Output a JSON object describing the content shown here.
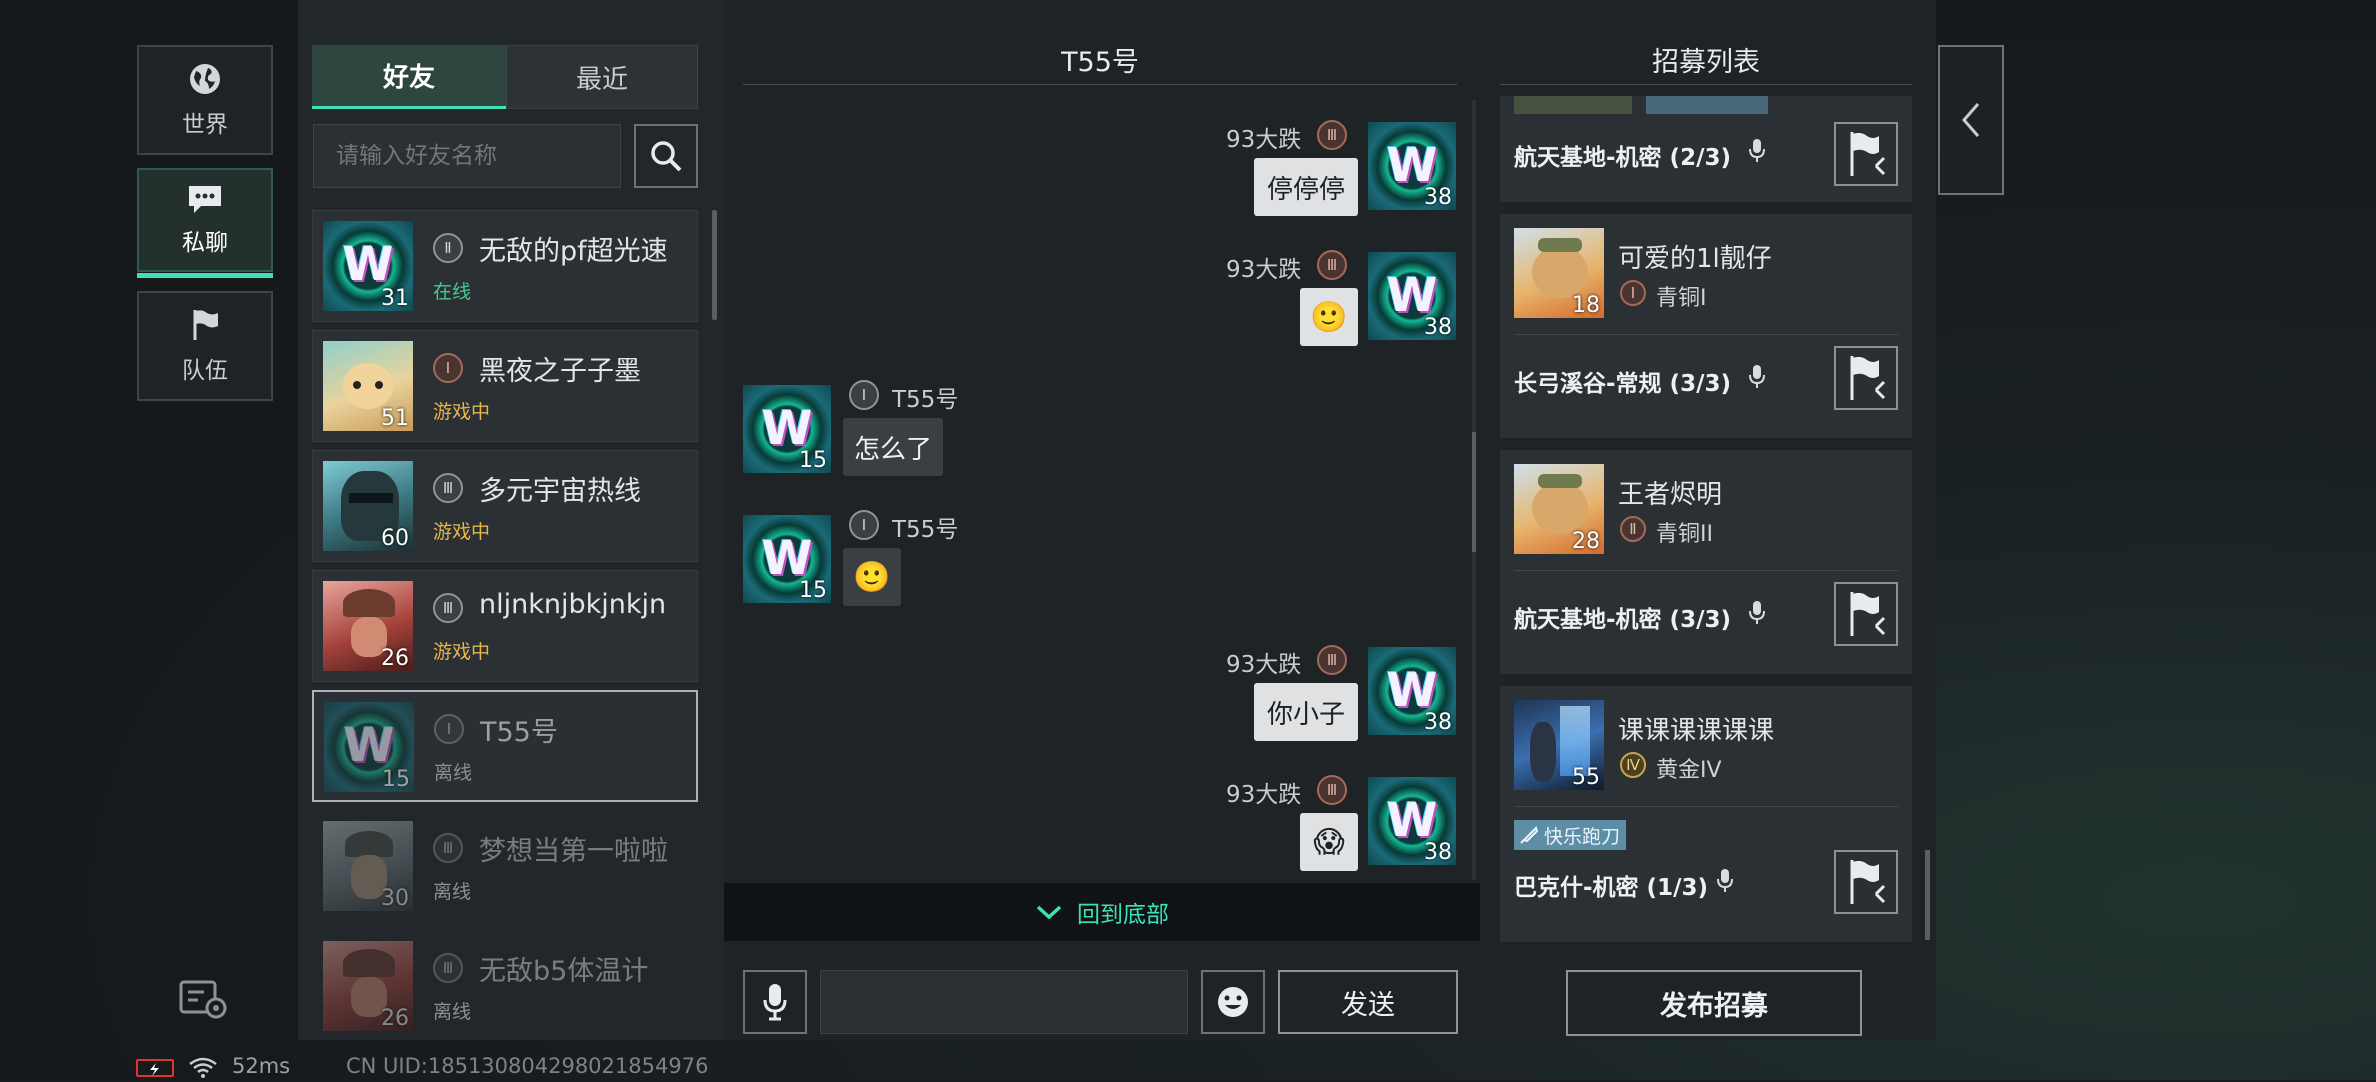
{
  "nav": {
    "world_label": "世界",
    "private_label": "私聊",
    "team_label": "队伍"
  },
  "friends_panel": {
    "tab_friends": "好友",
    "tab_recent": "最近",
    "search_placeholder": "请输入好友名称",
    "friends": [
      {
        "name": "无敌的pf超光速",
        "status": "在线",
        "level": "31",
        "rank_numeral": "Ⅱ",
        "avatar": "w-logo",
        "status_color": "#49c98e"
      },
      {
        "name": "黑夜之子子墨",
        "status": "游戏中",
        "level": "51",
        "rank_numeral": "Ⅰ",
        "avatar": "cartoon-dog",
        "status_color": "#e6b64a"
      },
      {
        "name": "多元宇宙热线",
        "status": "游戏中",
        "level": "60",
        "rank_numeral": "Ⅲ",
        "avatar": "armored-soldier",
        "status_color": "#e6b64a"
      },
      {
        "name": "nljnknjbkjnkjn",
        "status": "游戏中",
        "level": "26",
        "rank_numeral": "Ⅲ",
        "avatar": "red-soldier",
        "status_color": "#e6b64a"
      },
      {
        "name": "T55号",
        "status": "离线",
        "level": "15",
        "rank_numeral": "Ⅰ",
        "avatar": "w-logo",
        "status_color": "#8a8f93"
      },
      {
        "name": "梦想当第一啦啦",
        "status": "离线",
        "level": "30",
        "rank_numeral": "Ⅲ",
        "avatar": "soldier-portrait",
        "status_color": "#8a8f93"
      },
      {
        "name": "无敌b5体温计",
        "status": "离线",
        "level": "26",
        "rank_numeral": "Ⅲ",
        "avatar": "red-soldier",
        "status_color": "#8a8f93"
      }
    ]
  },
  "chat": {
    "title": "T55号",
    "messages": [
      {
        "side": "right",
        "sender": "93大跌",
        "rank_numeral": "Ⅲ",
        "text": "停停停",
        "level": "38"
      },
      {
        "side": "right",
        "sender": "93大跌",
        "rank_numeral": "Ⅲ",
        "text": "🙂",
        "level": "38"
      },
      {
        "side": "left",
        "sender": "T55号",
        "rank_numeral": "Ⅰ",
        "text": "怎么了",
        "level": "15"
      },
      {
        "side": "left",
        "sender": "T55号",
        "rank_numeral": "Ⅰ",
        "text": "🙂",
        "level": "15"
      },
      {
        "side": "right",
        "sender": "93大跌",
        "rank_numeral": "Ⅲ",
        "text": "你小子",
        "level": "38"
      },
      {
        "side": "right",
        "sender": "93大跌",
        "rank_numeral": "Ⅲ",
        "text": "😱",
        "level": "38"
      }
    ],
    "back_to_bottom": "回到底部",
    "send_label": "发送",
    "input_value": ""
  },
  "recruit": {
    "title": "招募列表",
    "entries": [
      {
        "map": "航天基地-机密 (2/3)"
      },
      {
        "player": "可爱的1l靓仔",
        "level": "18",
        "rank_numeral": "Ⅰ",
        "rank_text": "青铜I",
        "map": "长弓溪谷-常规 (3/3)"
      },
      {
        "player": "王者烬明",
        "level": "28",
        "rank_numeral": "Ⅱ",
        "rank_text": "青铜II",
        "map": "航天基地-机密 (3/3)"
      },
      {
        "player": "课课课课课课",
        "level": "55",
        "rank_numeral": "Ⅳ",
        "rank_text": "黄金IV",
        "tag": "快乐跑刀",
        "map": "巴克什-机密 (1/3)"
      }
    ],
    "publish_label": "发布招募"
  },
  "status_bar": {
    "ping": "52ms",
    "uid": "CN UID:18513080429802185497​6"
  },
  "colors": {
    "accent": "#3ee0b7",
    "online": "#49c98e",
    "in_game": "#e6b64a",
    "offline": "#8a8f93"
  }
}
